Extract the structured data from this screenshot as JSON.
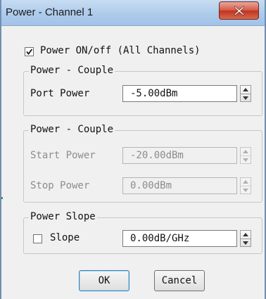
{
  "window": {
    "title": "Power - Channel 1",
    "close_glyph": "X"
  },
  "power_on": {
    "label": "Power ON/off (All Channels)",
    "checked": true
  },
  "group_port": {
    "title": "Power - Couple",
    "port_power_label": "Port Power",
    "port_power_value": "-5.00dBm"
  },
  "group_sweep": {
    "title": "Power - Couple",
    "start_power_label": "Start Power",
    "start_power_value": "-20.00dBm",
    "stop_power_label": "Stop Power",
    "stop_power_value": "0.00dBm"
  },
  "group_slope": {
    "title": "Power Slope",
    "slope_label": "Slope",
    "slope_checked": false,
    "slope_value": "0.00dB/GHz"
  },
  "buttons": {
    "ok": "OK",
    "cancel": "Cancel"
  },
  "icons": {
    "close": "close-icon",
    "check": "checkmark-icon",
    "spin_up": "spin-up-arrow-icon",
    "spin_down": "spin-down-arrow-icon"
  },
  "colors": {
    "titlebar": "#aecbeb",
    "close_button": "#c2321f",
    "dialog_bg": "#f0f0f0"
  }
}
